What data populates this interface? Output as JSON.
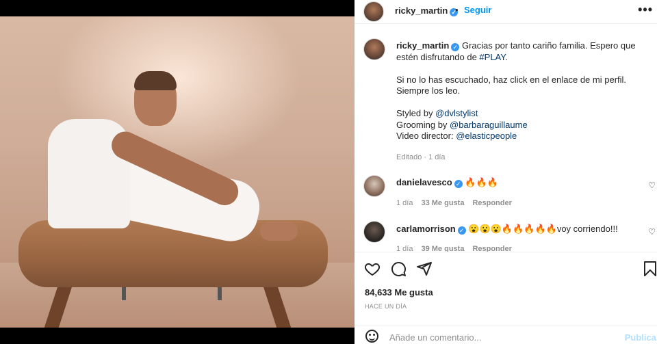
{
  "post": {
    "author": "ricky_martin",
    "follow_label": "Seguir",
    "separator": "•",
    "more_label": "•••"
  },
  "caption": {
    "author": "ricky_martin",
    "line1": "Gracias por tanto cariño familia. Espero que estén disfrutando de ",
    "hashtag": "#PLAY",
    "line1_end": ".",
    "para2": "Si no lo has escuchado, haz click en el enlace de mi perfil. Siempre los leo.",
    "styled_prefix": "Styled by ",
    "styled_by": "@dvlstylist",
    "grooming_prefix": "Grooming by ",
    "grooming_by": "@barbaraguillaume",
    "video_prefix": "Video director: ",
    "video_director": "@elasticpeople",
    "edited": "Editado · 1 día"
  },
  "comments": [
    {
      "author": "danielavesco",
      "text": "🔥🔥🔥",
      "time": "1 día",
      "likes": "33 Me gusta",
      "reply": "Responder"
    },
    {
      "author": "carlamorrison",
      "text": "😮😮😮🔥🔥🔥🔥🔥voy corriendo!!!",
      "time": "1 día",
      "likes": "39 Me gusta",
      "reply": "Responder"
    }
  ],
  "actions": {
    "likes_count": "84,633 Me gusta",
    "time_ago": "HACE UN DÍA"
  },
  "add_comment": {
    "placeholder": "Añade un comentario...",
    "publish": "Publicar"
  },
  "colors": {
    "link": "#00376b",
    "accent": "#0095f6",
    "verified": "#3897f0",
    "muted": "#8e8e8e"
  }
}
